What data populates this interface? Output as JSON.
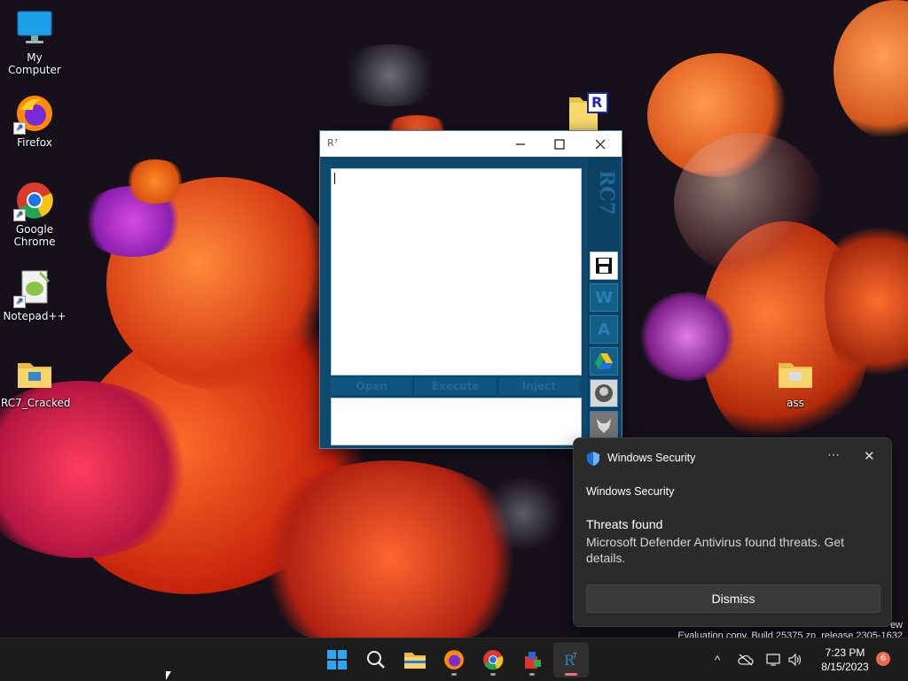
{
  "desktop": {
    "icons": [
      {
        "label": "My Computer",
        "icon": "monitor-icon"
      },
      {
        "label": "Firefox",
        "icon": "firefox-icon"
      },
      {
        "label": "Google Chrome",
        "icon": "chrome-icon"
      },
      {
        "label": "Notepad++",
        "icon": "notepad-plus-plus-icon"
      },
      {
        "label": "RC7_Cracked",
        "icon": "folder-icon"
      },
      {
        "label": "ass",
        "icon": "folder-icon"
      }
    ],
    "floating_icon_letter": "R"
  },
  "rc7_window": {
    "title_glyph": "R⁷",
    "logo": "RC7",
    "buttons": {
      "open": "Open",
      "execute": "Execute",
      "inject": "Inject"
    },
    "sidebar": [
      "save-icon",
      "W",
      "A",
      "google-drive-icon",
      "avatar-icon",
      "wolf-icon"
    ],
    "sidebar_w": "W",
    "sidebar_a": "A"
  },
  "toast": {
    "app_name": "Windows Security",
    "more": "⋯",
    "close": "✕",
    "source": "Windows Security",
    "heading": "Threats found",
    "body": "Microsoft Defender Antivirus found threats. Get details.",
    "dismiss": "Dismiss"
  },
  "watermark": {
    "line1": "ew",
    "line2": "Evaluation copy. Build 25375.zn_release.2305-1632"
  },
  "taskbar": {
    "apps": [
      "start-icon",
      "search-icon",
      "file-explorer-icon",
      "firefox-icon",
      "chrome-icon",
      "app-icon",
      "rc7-icon"
    ],
    "tray": {
      "chevron": "^",
      "time": "7:23 PM",
      "date": "8/15/2023",
      "notifications": "6"
    }
  },
  "colors": {
    "accent": "#0e4a6e",
    "toast_bg": "#2b2b2b",
    "taskbar_bg": "#1c1c1c"
  }
}
